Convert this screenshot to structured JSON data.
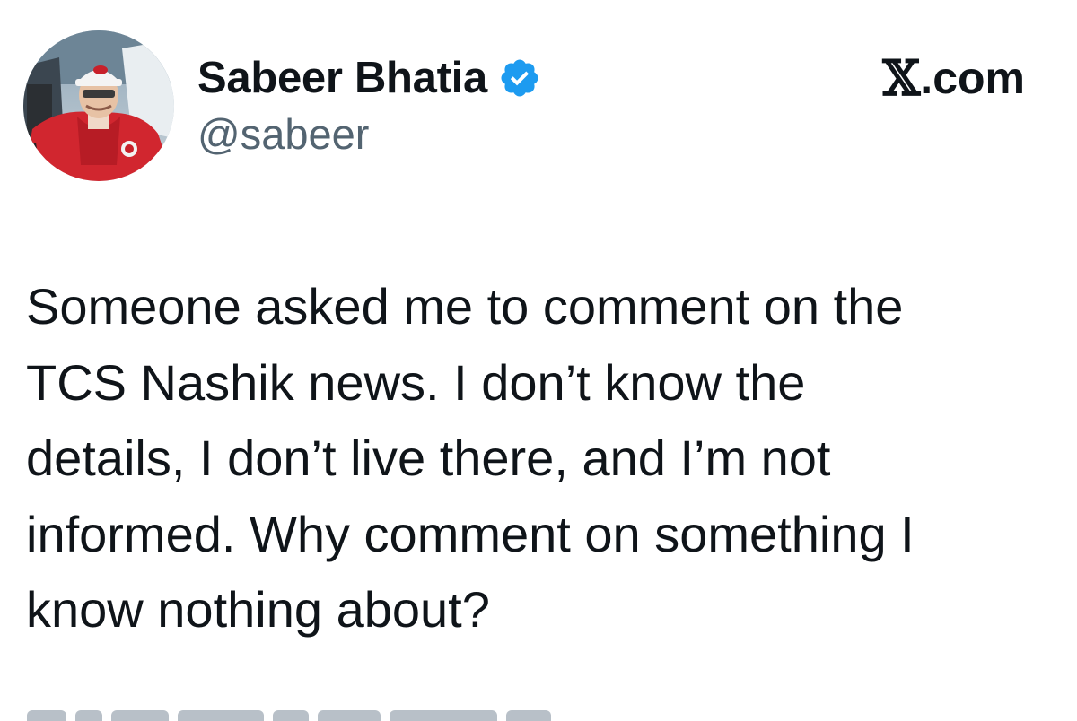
{
  "author": {
    "display_name": "Sabeer Bhatia",
    "handle": "@sabeer",
    "verified": true,
    "avatar": "profile-photo"
  },
  "source": {
    "logo": "𝕏",
    "domain": ".com"
  },
  "tweet": {
    "lines": [
      "Someone asked me to comment on the",
      "TCS Nashik news. I don’t know the",
      "details, I don’t live there, and I’m not",
      "informed. Why comment on something I",
      "know nothing about?"
    ]
  },
  "colors": {
    "text_primary": "#0f1419",
    "text_secondary": "#536471",
    "verified_blue": "#1d9bf0",
    "background": "#ffffff"
  },
  "icons": {
    "verified": "verified-badge-icon",
    "brand": "x-logo-icon"
  }
}
